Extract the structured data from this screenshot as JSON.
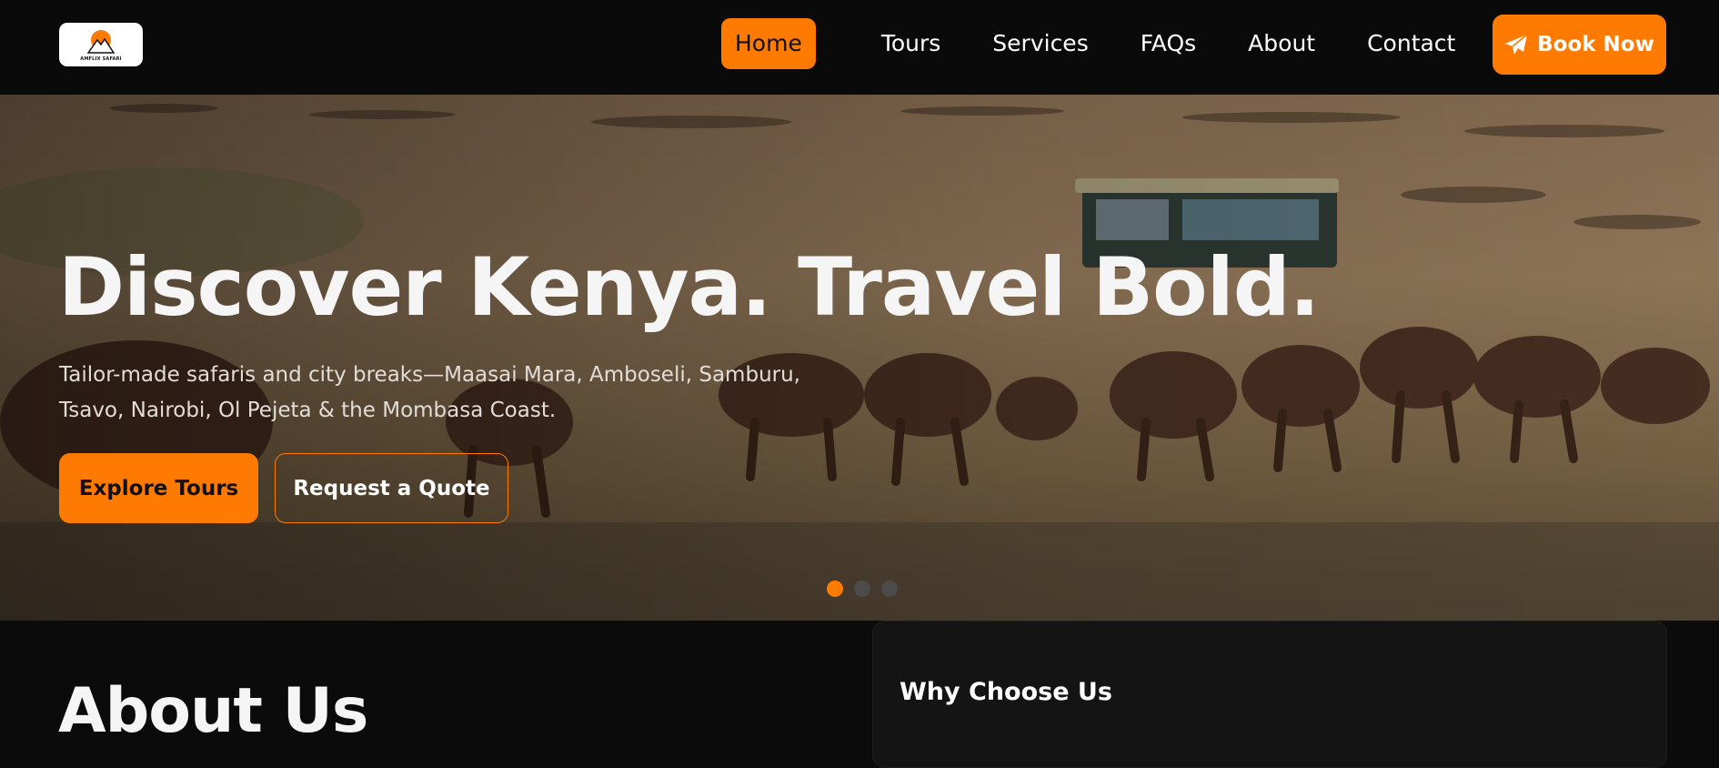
{
  "brand": {
    "logo_text": "AMFLIX SAFARI"
  },
  "nav": {
    "items": [
      {
        "label": "Home",
        "active": true
      },
      {
        "label": "Tours"
      },
      {
        "label": "Services"
      },
      {
        "label": "FAQs"
      },
      {
        "label": "About"
      },
      {
        "label": "Contact"
      }
    ],
    "cta": {
      "label": "Book Now",
      "icon": "paper-plane-icon"
    }
  },
  "hero": {
    "title": "Discover Kenya. Travel Bold.",
    "subtitle_line1": "Tailor-made safaris and city breaks—Maasai Mara, Amboseli, Samburu,",
    "subtitle_line2": "Tsavo, Nairobi, Ol Pejeta & the Mombasa Coast.",
    "primary_button": "Explore Tours",
    "secondary_button": "Request a Quote",
    "slides": {
      "count": 3,
      "active": 1
    }
  },
  "about": {
    "title": "About Us"
  },
  "why": {
    "title": "Why Choose Us"
  },
  "colors": {
    "accent": "#ff7a00",
    "background": "#0b0b0b",
    "card": "#141414"
  }
}
